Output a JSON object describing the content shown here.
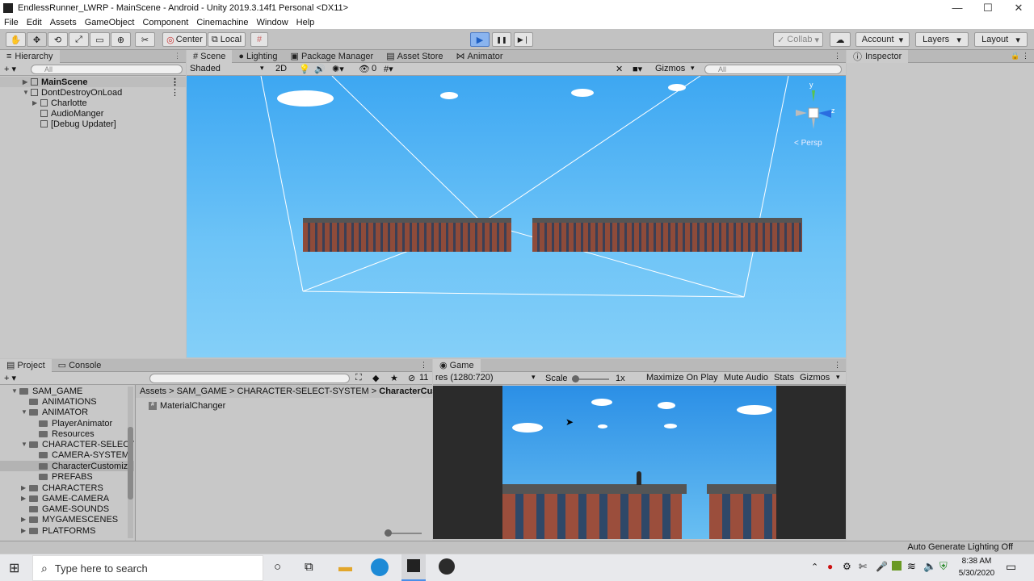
{
  "window": {
    "title": "EndlessRunner_LWRP - MainScene - Android - Unity 2019.3.14f1 Personal <DX11>",
    "min": "—",
    "max": "☐",
    "close": "✕"
  },
  "menu": [
    "File",
    "Edit",
    "Assets",
    "GameObject",
    "Component",
    "Cinemachine",
    "Window",
    "Help"
  ],
  "toolbar": {
    "pivot": "Center",
    "space": "Local",
    "collab": "Collab",
    "account": "Account",
    "layers": "Layers",
    "layout": "Layout",
    "play": "▶",
    "pause": "❚❚",
    "step": "▶❘"
  },
  "hierarchy": {
    "tab": "Hierarchy",
    "search": "All",
    "add": "+ ▾",
    "items": [
      {
        "label": "MainScene",
        "bold": true
      },
      {
        "label": "DontDestroyOnLoad",
        "bold": false
      },
      {
        "label": "Charlotte"
      },
      {
        "label": "AudioManger"
      },
      {
        "label": "[Debug Updater]"
      }
    ]
  },
  "scene_tabs": [
    "Scene",
    "Lighting",
    "Package Manager",
    "Asset Store",
    "Animator"
  ],
  "scene_toolbar": {
    "shading": "Shaded",
    "mode2d": "2D",
    "hidden": "0",
    "gizmos": "Gizmos",
    "search": "All",
    "persp": "< Persp",
    "axis_y": "y",
    "axis_z": "z"
  },
  "inspector": {
    "tab": "Inspector"
  },
  "project": {
    "tabs": [
      "Project",
      "Console"
    ],
    "add": "+ ▾",
    "count": "11",
    "tree": [
      {
        "label": "SAM_GAME",
        "depth": 0,
        "arrow": "▼"
      },
      {
        "label": "ANIMATIONS",
        "depth": 1,
        "arrow": ""
      },
      {
        "label": "ANIMATOR",
        "depth": 1,
        "arrow": "▼"
      },
      {
        "label": "PlayerAnimator",
        "depth": 2,
        "arrow": ""
      },
      {
        "label": "Resources",
        "depth": 2,
        "arrow": ""
      },
      {
        "label": "CHARACTER-SELECT",
        "depth": 1,
        "arrow": "▼"
      },
      {
        "label": "CAMERA-SYSTEM",
        "depth": 2,
        "arrow": ""
      },
      {
        "label": "CharacterCustomiz",
        "depth": 2,
        "arrow": ""
      },
      {
        "label": "PREFABS",
        "depth": 2,
        "arrow": ""
      },
      {
        "label": "CHARACTERS",
        "depth": 1,
        "arrow": "▶"
      },
      {
        "label": "GAME-CAMERA",
        "depth": 1,
        "arrow": "▶"
      },
      {
        "label": "GAME-SOUNDS",
        "depth": 1,
        "arrow": ""
      },
      {
        "label": "MYGAMESCENES",
        "depth": 1,
        "arrow": "▶"
      },
      {
        "label": "PLATFORMS",
        "depth": 1,
        "arrow": "▶"
      }
    ],
    "breadcrumb": [
      "Assets",
      "SAM_GAME",
      "CHARACTER-SELECT-SYSTEM",
      "CharacterCusto"
    ],
    "sep": ">",
    "file": "MaterialChanger"
  },
  "game": {
    "tab": "Game",
    "resolution": "res (1280:720)",
    "scale_label": "Scale",
    "scale_value": "1x",
    "maximize": "Maximize On Play",
    "mute": "Mute Audio",
    "stats": "Stats",
    "gizmos": "Gizmos"
  },
  "status": {
    "text": "Auto Generate Lighting Off"
  },
  "taskbar": {
    "search": "Type here to search",
    "time": "8:38 AM",
    "date": "5/30/2020"
  },
  "colors": {
    "play_active": "#4a8ee8",
    "sky": "#5bb8f4",
    "brick": "#8e4b3a"
  }
}
